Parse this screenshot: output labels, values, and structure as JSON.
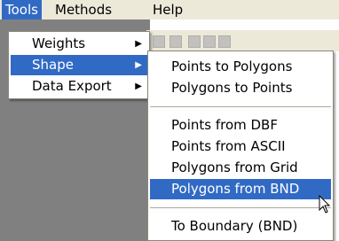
{
  "menubar": {
    "items": [
      "Tools",
      "Methods",
      "Help"
    ]
  },
  "tools_menu": {
    "items": [
      {
        "label": "Weights",
        "has_submenu": true
      },
      {
        "label": "Shape",
        "has_submenu": true,
        "highlighted": true
      },
      {
        "label": "Data Export",
        "has_submenu": true
      }
    ]
  },
  "shape_submenu": {
    "items": [
      {
        "label": "Points to Polygons"
      },
      {
        "label": "Polygons to Points"
      },
      {
        "label": "Points from DBF"
      },
      {
        "label": "Points from ASCII"
      },
      {
        "label": "Polygons from Grid"
      },
      {
        "label": "Polygons from BND",
        "highlighted": true
      },
      {
        "label": "To Boundary (BND)"
      }
    ]
  },
  "icons": {
    "submenu_arrow": "arrow-right-icon",
    "cursor": "mouse-pointer-icon"
  },
  "colors": {
    "menu_highlight": "#316ac5",
    "menubar_bg": "#ece9d8",
    "app_bg": "#808080"
  }
}
